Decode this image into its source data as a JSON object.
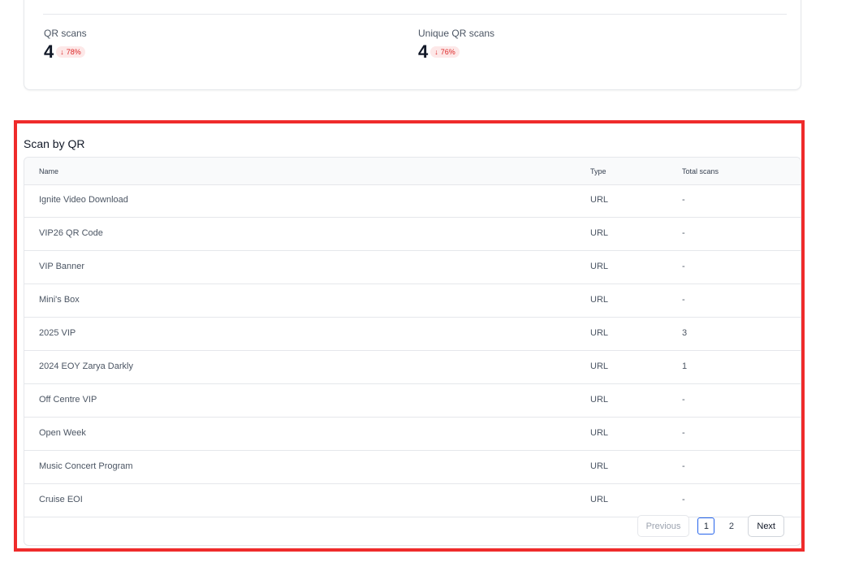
{
  "stats": {
    "items": [
      {
        "label": "QR scans",
        "value": "4",
        "change": "78%",
        "direction": "down"
      },
      {
        "label": "Unique QR scans",
        "value": "4",
        "change": "76%",
        "direction": "down"
      }
    ]
  },
  "scan_by_qr": {
    "title": "Scan by QR",
    "columns": {
      "name": "Name",
      "type": "Type",
      "total": "Total scans"
    },
    "rows": [
      {
        "name": "Ignite Video Download",
        "type": "URL",
        "total": "-"
      },
      {
        "name": "VIP26 QR Code",
        "type": "URL",
        "total": "-"
      },
      {
        "name": "VIP Banner",
        "type": "URL",
        "total": "-"
      },
      {
        "name": "Mini's Box",
        "type": "URL",
        "total": "-"
      },
      {
        "name": "2025 VIP",
        "type": "URL",
        "total": "3"
      },
      {
        "name": "2024 EOY Zarya Darkly",
        "type": "URL",
        "total": "1"
      },
      {
        "name": "Off Centre VIP",
        "type": "URL",
        "total": "-"
      },
      {
        "name": "Open Week",
        "type": "URL",
        "total": "-"
      },
      {
        "name": "Music Concert Program",
        "type": "URL",
        "total": "-"
      },
      {
        "name": "Cruise EOI",
        "type": "URL",
        "total": "-"
      }
    ],
    "pagination": {
      "previous_label": "Previous",
      "next_label": "Next",
      "pages": [
        "1",
        "2"
      ],
      "current_page": "1"
    }
  },
  "colors": {
    "highlight": "#ef2b2b",
    "badge_bg": "#fde8e8",
    "badge_text": "#dc2626",
    "active_page_border": "#2563eb"
  },
  "icons": {
    "change_arrow": "arrow-down-icon"
  }
}
